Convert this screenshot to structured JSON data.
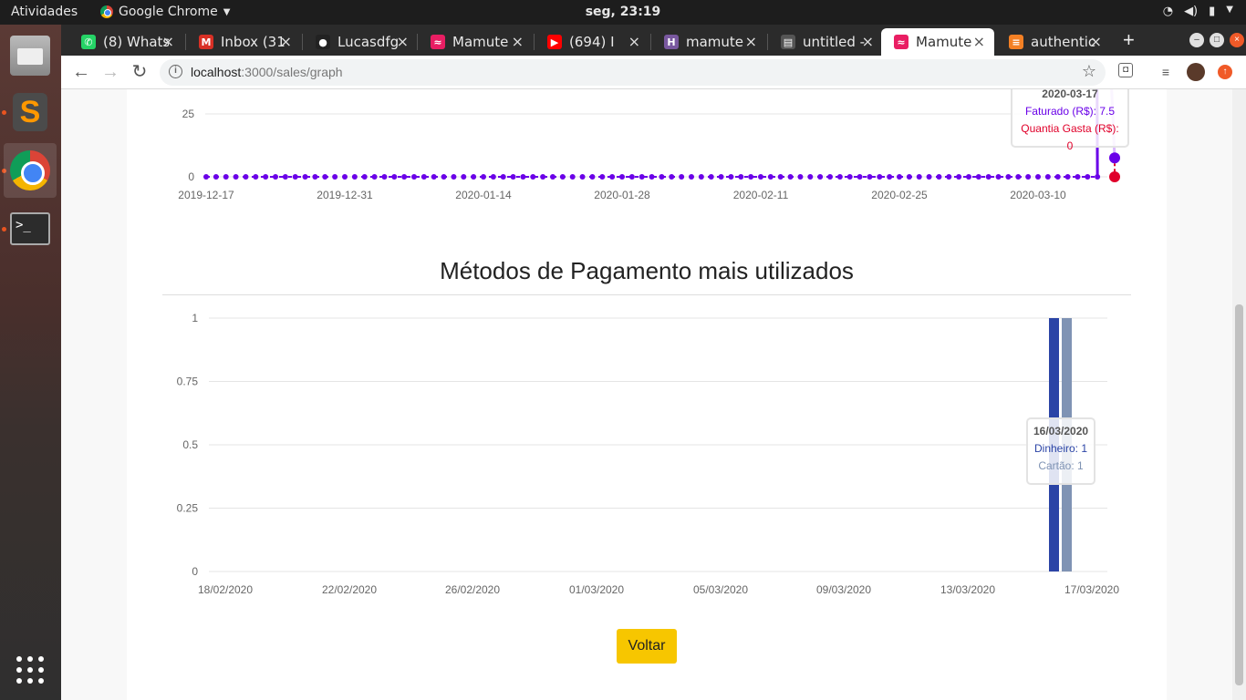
{
  "system": {
    "activities": "Atividades",
    "app_name": "Google Chrome",
    "clock": "seg, 23:19"
  },
  "browser": {
    "tabs": [
      {
        "title": "(8) Whats",
        "favicon": "whatsapp-icon",
        "color": "#25d366"
      },
      {
        "title": "Inbox (31",
        "favicon": "gmail-icon",
        "color": "#d93025"
      },
      {
        "title": "Lucasdfg",
        "favicon": "github-icon",
        "color": "#222222"
      },
      {
        "title": "Mamute",
        "favicon": "mamute-icon",
        "color": "#e91e63"
      },
      {
        "title": "(694) I",
        "favicon": "youtube-icon",
        "color": "#ff0000"
      },
      {
        "title": "mamute",
        "favicon": "heroku-icon",
        "color": "#79589f"
      },
      {
        "title": "untitled -",
        "favicon": "document-icon",
        "color": "#555555"
      },
      {
        "title": "Mamute",
        "favicon": "mamute-icon",
        "color": "#e91e63",
        "active": true
      },
      {
        "title": "authentic",
        "favicon": "stackoverflow-icon",
        "color": "#f48024"
      }
    ],
    "url_host": "localhost",
    "url_path": ":3000/sales/graph"
  },
  "chart1": {
    "y_ticks": [
      "25",
      "0"
    ],
    "x_ticks": [
      "2019-12-17",
      "2019-12-31",
      "2020-01-14",
      "2020-01-28",
      "2020-02-11",
      "2020-02-25",
      "2020-03-10"
    ],
    "tooltip": {
      "date": "2020-03-17",
      "line1": "Faturado (R$): 7.5",
      "line2": "Quantia Gasta (R$): 0"
    },
    "colors": {
      "faturado": "#6a00e8",
      "gasta": "#e0002a"
    }
  },
  "chart2": {
    "title": "Métodos de Pagamento mais utilizados",
    "y_ticks": [
      "1",
      "0.75",
      "0.5",
      "0.25",
      "0"
    ],
    "x_ticks": [
      "18/02/2020",
      "22/02/2020",
      "26/02/2020",
      "01/03/2020",
      "05/03/2020",
      "09/03/2020",
      "13/03/2020",
      "17/03/2020"
    ],
    "tooltip": {
      "date": "16/03/2020",
      "line1": "Dinheiro: 1",
      "line2": "Cartão: 1"
    },
    "colors": {
      "dinheiro": "#2b44a6",
      "cartao": "#7f93b4"
    }
  },
  "chart_data": [
    {
      "type": "line",
      "x": [
        "2019-12-17",
        "2020-03-16",
        "2020-03-17"
      ],
      "series": [
        {
          "name": "Faturado (R$)",
          "values": [
            0,
            0,
            7.5
          ]
        },
        {
          "name": "Quantia Gasta (R$)",
          "values": [
            0,
            0,
            0
          ]
        }
      ],
      "xlabel": "",
      "ylabel": ""
    },
    {
      "type": "bar",
      "title": "Métodos de Pagamento mais utilizados",
      "categories": [
        "16/03/2020"
      ],
      "series": [
        {
          "name": "Dinheiro",
          "values": [
            1
          ]
        },
        {
          "name": "Cartão",
          "values": [
            1
          ]
        }
      ],
      "ylim": [
        0,
        1
      ],
      "xlabel": "",
      "ylabel": ""
    }
  ],
  "actions": {
    "back_label": "Voltar"
  }
}
